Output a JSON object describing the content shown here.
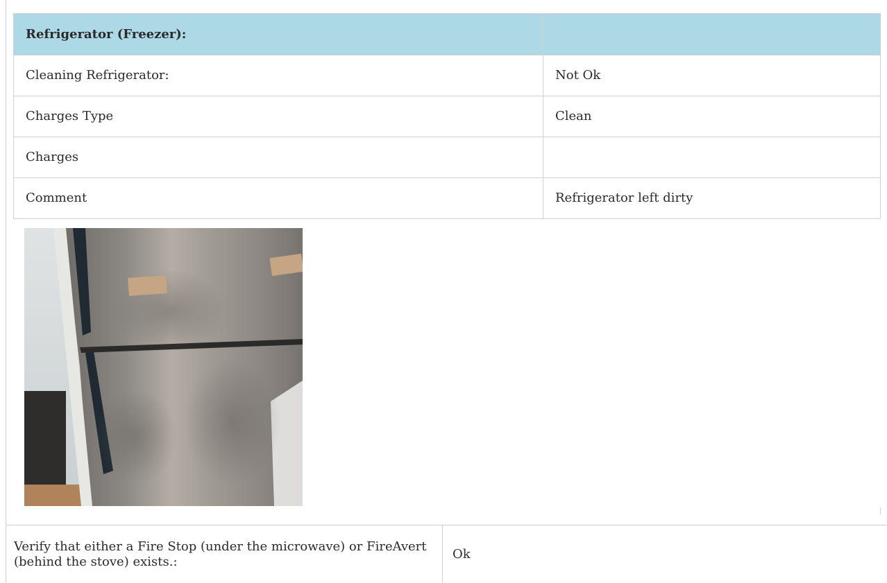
{
  "fridge_section": {
    "header": {
      "label": "Refrigerator (Freezer):",
      "value": ""
    },
    "rows": [
      {
        "label": "Cleaning Refrigerator:",
        "value": "Not Ok"
      },
      {
        "label": "Charges Type",
        "value": "Clean"
      },
      {
        "label": "Charges",
        "value": ""
      },
      {
        "label": "Comment",
        "value": "Refrigerator left dirty"
      }
    ]
  },
  "fire_section": {
    "label": "Verify that either a Fire Stop (under the microwave) or FireAvert (behind the stove) exists.:",
    "value": "Ok"
  },
  "colors": {
    "header_background": "#add8e6",
    "border": "#d0d0d0"
  }
}
